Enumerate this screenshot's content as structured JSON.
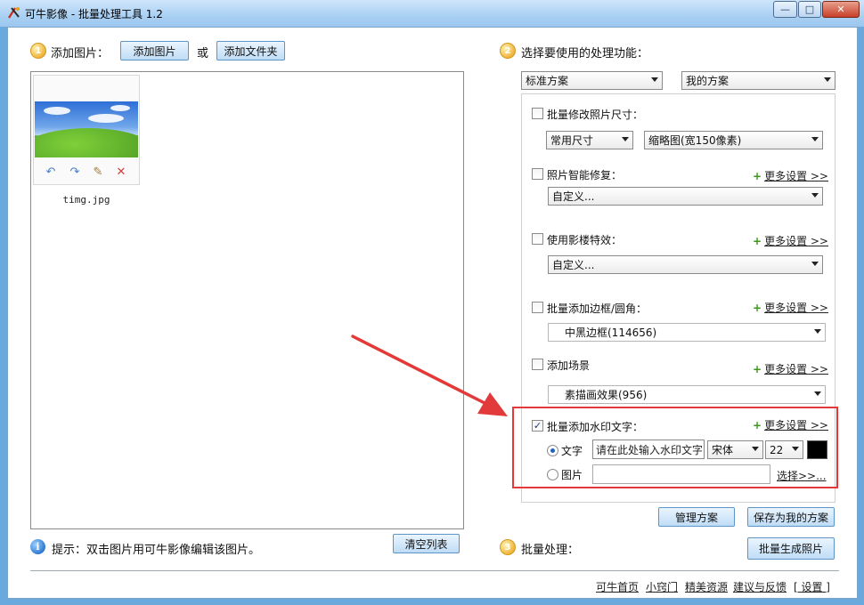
{
  "window": {
    "title": "可牛影像 - 批量处理工具 1.2",
    "controls": {
      "minimize": "—",
      "maximize": "□",
      "close": "✕"
    }
  },
  "step1": {
    "number": "1",
    "label": "添加图片：",
    "add_image_button": "添加图片",
    "or_text": "或",
    "add_folder_button": "添加文件夹"
  },
  "image_list": {
    "items": [
      {
        "file_name": "timg.jpg"
      }
    ],
    "tools": {
      "rotate_left": "↶",
      "rotate_right": "↷",
      "edit": "✎",
      "delete": "✕"
    }
  },
  "hint": {
    "icon_glyph": "i",
    "text": "提示：双击图片用可牛影像编辑该图片。",
    "clear_button": "清空列表"
  },
  "step2": {
    "number": "2",
    "label": "选择要使用的处理功能：",
    "standard_scheme": "标准方案",
    "my_scheme": "我的方案"
  },
  "options": {
    "resize": {
      "label": "批量修改照片尺寸：",
      "checked": false,
      "size_mode": "常用尺寸",
      "size_value": "缩略图(宽150像素)"
    },
    "repair": {
      "label": "照片智能修复：",
      "checked": false,
      "more": "更多设置 >>",
      "value": "自定义..."
    },
    "effects": {
      "label": "使用影楼特效：",
      "checked": false,
      "more": "更多设置 >>",
      "value": "自定义..."
    },
    "border": {
      "label": "批量添加边框/圆角：",
      "checked": false,
      "more": "更多设置 >>",
      "value": "中黑边框(114656)"
    },
    "scene": {
      "label": "添加场景",
      "checked": false,
      "more": "更多设置 >>",
      "value": "素描画效果(956)"
    },
    "watermark": {
      "label": "批量添加水印文字：",
      "checked": true,
      "check_glyph": "✓",
      "more": "更多设置 >>",
      "text_option": "文字",
      "text_selected": true,
      "text_placeholder": "请在此处输入水印文字",
      "font": "宋体",
      "font_size": "22",
      "color": "#000000",
      "image_option": "图片",
      "image_path": "",
      "choose_link": "选择>>..."
    }
  },
  "scheme_buttons": {
    "manage": "管理方案",
    "save": "保存为我的方案"
  },
  "step3": {
    "number": "3",
    "label": "批量处理：",
    "generate_button": "批量生成照片"
  },
  "footer": {
    "links": [
      "可牛首页",
      "小窍门",
      "精美资源",
      "建议与反馈",
      "[ 设置 ]"
    ]
  },
  "colors": {
    "annotation_red": "#e23a3a",
    "step_orange": "#f0b53a",
    "button_blue": "#bfdcf6"
  }
}
